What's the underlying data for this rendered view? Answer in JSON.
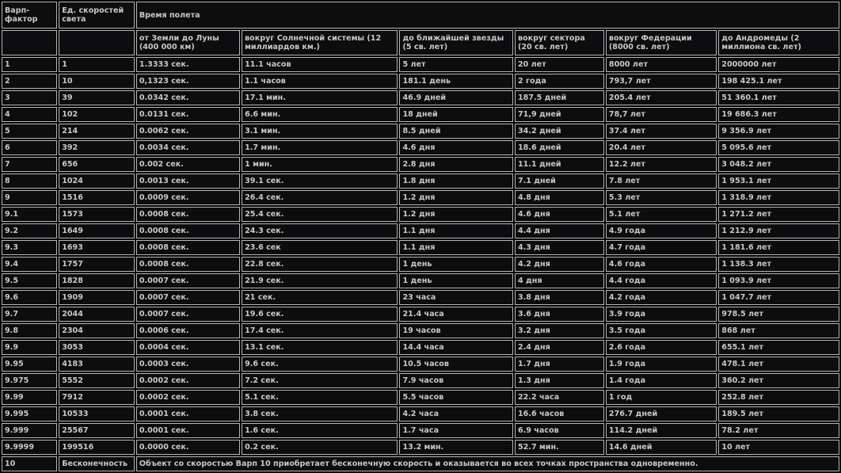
{
  "header": {
    "warp_factor": "Варп-фактор",
    "light_units": "Ед. скоростей света",
    "flight_time": "Время полета",
    "columns": [
      "от Земли до Луны (400 000 км)",
      "вокруг Солнечной системы (12 миллиардов км.)",
      "до ближайшей звезды (5 св. лет)",
      "вокруг сектора (20 св. лет)",
      "вокруг Федерации (8000 св. лет)",
      "до Андромеды (2 миллиона св. лет)"
    ]
  },
  "rows": [
    [
      "1",
      "1",
      "1.3333 сек.",
      "11.1 часов",
      "5 лет",
      "20 лет",
      "8000 лет",
      "2000000 лет"
    ],
    [
      "2",
      "10",
      "0,1323 сек.",
      "1.1 часов",
      "181.1 день",
      "2 года",
      "793,7 лет",
      "198 425.1 лет"
    ],
    [
      "3",
      "39",
      "0.0342 сек.",
      "17.1 мин.",
      "46.9 дней",
      "187.5 дней",
      "205.4 лет",
      "51 360.1 лет"
    ],
    [
      "4",
      "102",
      "0.0131 сек.",
      "6.6 мин.",
      "18 дней",
      "71,9 дней",
      "78,7 лет",
      "19 686.3 лет"
    ],
    [
      "5",
      "214",
      "0.0062 сек.",
      "3.1 мин.",
      "8.5 дней",
      "34.2 дней",
      "37.4 лет",
      "9 356.9 лет"
    ],
    [
      "6",
      "392",
      "0.0034 сек.",
      "1.7 мин.",
      "4.6 дня",
      "18.6 дней",
      "20.4 лет",
      "5 095.6 лет"
    ],
    [
      "7",
      "656",
      "0.002 сек.",
      "1 мин.",
      "2.8 дня",
      "11.1 дней",
      "12.2 лет",
      "3 048.2 лет"
    ],
    [
      "8",
      "1024",
      "0.0013 сек.",
      "39.1 сек.",
      "1.8 дня",
      "7.1 дней",
      "7.8 лет",
      "1 953.1 лет"
    ],
    [
      "9",
      "1516",
      "0.0009 сек.",
      "26.4 сек.",
      "1.2 дня",
      "4.8 дня",
      "5.3 лет",
      "1 318.9 лет"
    ],
    [
      "9.1",
      "1573",
      "0.0008 сек.",
      "25.4 сек.",
      "1.2 дня",
      "4.6 дня",
      "5.1 лет",
      "1 271.2 лет"
    ],
    [
      "9.2",
      "1649",
      "0.0008 сек.",
      "24.3 сек.",
      "1.1 дня",
      "4.4 дня",
      "4.9 года",
      "1 212.9 лет"
    ],
    [
      "9.3",
      "1693",
      "0.0008 сек.",
      "23.6 сек",
      "1.1 дня",
      "4.3 дня",
      "4.7 года",
      "1 181.6 лет"
    ],
    [
      "9.4",
      "1757",
      "0.0008 сек.",
      "22.8 сек.",
      "1 день",
      "4.2 дня",
      "4.6 года",
      "1 138.3 лет"
    ],
    [
      "9.5",
      "1828",
      "0.0007 сек.",
      "21.9 сек.",
      "1 день",
      "4 дня",
      "4.4 года",
      "1 093.9 лет"
    ],
    [
      "9.6",
      "1909",
      "0.0007 сек.",
      "21 сек.",
      "23 часа",
      "3.8 дня",
      "4.2 года",
      "1 047.7 лет"
    ],
    [
      "9.7",
      "2044",
      "0.0007 сек.",
      "19.6 сек.",
      "21.4 часа",
      "3.6 дня",
      "3.9 года",
      "978.5 лет"
    ],
    [
      "9.8",
      "2304",
      "0.0006 сек.",
      "17.4 сек.",
      "19 часов",
      "3.2 дня",
      "3.5 года",
      "868 лет"
    ],
    [
      "9.9",
      "3053",
      "0.0004 сек.",
      "13.1 сек.",
      "14.4 часа",
      "2.4 дня",
      "2.6 года",
      "655.1 лет"
    ],
    [
      "9.95",
      "4183",
      "0.0003 сек.",
      "9.6 сек.",
      "10.5 часов",
      "1.7 дня",
      "1.9 года",
      "478.1 лет"
    ],
    [
      "9.975",
      "5552",
      "0.0002 сек.",
      "7.2 сек.",
      "7.9 часов",
      "1.3 дня",
      "1.4 года",
      "360.2 лет"
    ],
    [
      "9.99",
      "7912",
      "0.0002 сек.",
      "5.1 сек.",
      "5.5 часов",
      "22.2 часа",
      "1 год",
      "252.8 лет"
    ],
    [
      "9.995",
      "10533",
      "0.0001 сек.",
      "3.8 сек.",
      "4.2 часа",
      "16.6 часов",
      "276.7 дней",
      "189.5 лет"
    ],
    [
      "9.999",
      "25567",
      "0.0001 сек.",
      "1.6 сек.",
      "1.7 часа",
      "6.9 часов",
      "114.2 дней",
      "78.2 лет"
    ],
    [
      "9.9999",
      "199516",
      "0.0000 сек.",
      "0.2 сек.",
      "13.2 мин.",
      "52.7 мин.",
      "14.6 дней",
      "10 лет"
    ]
  ],
  "last_row": {
    "warp": "10",
    "speed": "Бесконечность",
    "note": "Объект со скоростью Варп 10 приобретает бесконечную скорость и оказывается во всех точках пространства одновременно."
  }
}
